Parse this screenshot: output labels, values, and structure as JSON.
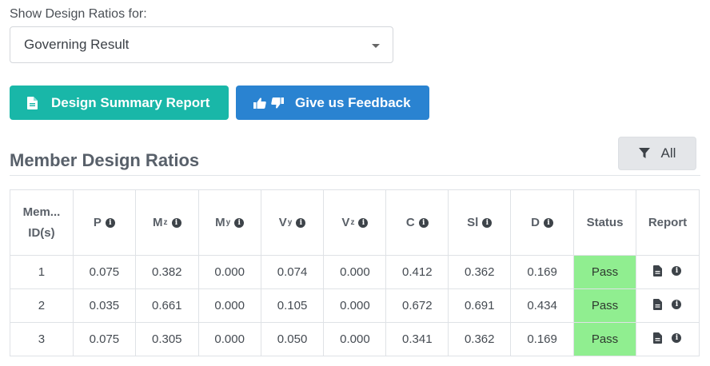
{
  "filter": {
    "label": "Show Design Ratios for:",
    "selected": "Governing Result"
  },
  "buttons": {
    "summary_label": "Design Summary Report",
    "feedback_label": "Give us Feedback",
    "all_label": "All"
  },
  "section": {
    "title": "Member Design Ratios"
  },
  "table": {
    "headers": {
      "member": "Mem...",
      "member2": "ID(s)",
      "p": "P",
      "mz": "M",
      "mz_sub": "z",
      "my": "M",
      "my_sub": "y",
      "vy": "V",
      "vy_sub": "y",
      "vz": "V",
      "vz_sub": "z",
      "c": "C",
      "sl": "Sl",
      "d": "D",
      "status": "Status",
      "report": "Report"
    },
    "rows": [
      {
        "id": "1",
        "p": "0.075",
        "mz": "0.382",
        "my": "0.000",
        "vy": "0.074",
        "vz": "0.000",
        "c": "0.412",
        "sl": "0.362",
        "d": "0.169",
        "status": "Pass"
      },
      {
        "id": "2",
        "p": "0.035",
        "mz": "0.661",
        "my": "0.000",
        "vy": "0.105",
        "vz": "0.000",
        "c": "0.672",
        "sl": "0.691",
        "d": "0.434",
        "status": "Pass"
      },
      {
        "id": "3",
        "p": "0.075",
        "mz": "0.305",
        "my": "0.000",
        "vy": "0.050",
        "vz": "0.000",
        "c": "0.341",
        "sl": "0.362",
        "d": "0.169",
        "status": "Pass"
      }
    ],
    "info_glyph": "i"
  },
  "colors": {
    "summary_button": "#19b7a8",
    "feedback_button": "#2a83d1",
    "pass_cell": "#90ee90"
  },
  "icons": {
    "summary": "file-text-icon",
    "feedback": "thumbs-up-down-icon",
    "filter": "filter-icon",
    "report": "file-icon",
    "info": "info-circle-icon"
  }
}
